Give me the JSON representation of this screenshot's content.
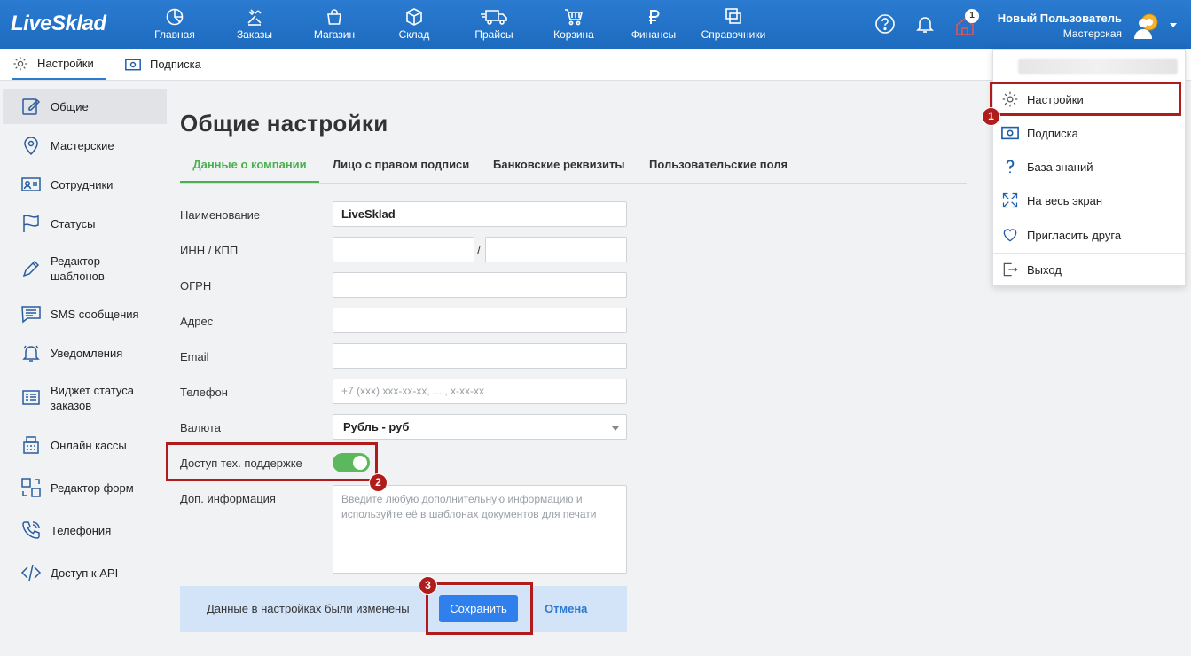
{
  "app": {
    "logo": "LiveSklad"
  },
  "nav": [
    {
      "label": "Главная",
      "icon": "pie-chart-icon"
    },
    {
      "label": "Заказы",
      "icon": "tools-icon"
    },
    {
      "label": "Магазин",
      "icon": "bag-icon"
    },
    {
      "label": "Склад",
      "icon": "box-icon"
    },
    {
      "label": "Прайсы",
      "icon": "truck-icon"
    },
    {
      "label": "Корзина",
      "icon": "cart-icon"
    },
    {
      "label": "Финансы",
      "icon": "ruble-icon"
    },
    {
      "label": "Справочники",
      "icon": "copy-icon"
    }
  ],
  "header": {
    "notification_count": "1",
    "user_name": "Новый Пользователь",
    "user_role": "Мастерская"
  },
  "subtabs": [
    {
      "label": "Настройки",
      "icon": "gear-icon"
    },
    {
      "label": "Подписка",
      "icon": "banknote-icon"
    }
  ],
  "sidebar": [
    {
      "label": "Общие",
      "icon": "edit-icon"
    },
    {
      "label": "Мастерские",
      "icon": "map-pin-icon"
    },
    {
      "label": "Сотрудники",
      "icon": "id-card-icon"
    },
    {
      "label": "Статусы",
      "icon": "flag-icon"
    },
    {
      "label": "Редактор шаблонов",
      "icon": "pencil-icon"
    },
    {
      "label": "SMS сообщения",
      "icon": "message-icon"
    },
    {
      "label": "Уведомления",
      "icon": "bell-icon"
    },
    {
      "label": "Виджет статуса заказов",
      "icon": "widget-icon"
    },
    {
      "label": "Онлайн кассы",
      "icon": "cash-register-icon"
    },
    {
      "label": "Редактор форм",
      "icon": "form-editor-icon"
    },
    {
      "label": "Телефония",
      "icon": "phone-icon"
    },
    {
      "label": "Доступ к API",
      "icon": "code-icon"
    }
  ],
  "main": {
    "title": "Общие настройки",
    "tabs": [
      "Данные о компании",
      "Лицо с правом подписи",
      "Банковские реквизиты",
      "Пользовательские поля"
    ],
    "fields": {
      "name_label": "Наименование",
      "name_value": "LiveSklad",
      "inn_label": "ИНН / КПП",
      "slash": "/",
      "ogrn_label": "ОГРН",
      "address_label": "Адрес",
      "email_label": "Email",
      "phone_label": "Телефон",
      "phone_placeholder": "+7 (xxx) xxx-xx-xx, ... , x-xx-xx",
      "currency_label": "Валюта",
      "currency_value": "Рубль - руб",
      "support_label": "Доступ тех. поддержке",
      "support_enabled": true,
      "info_label": "Доп. информация",
      "info_placeholder": "Введите любую дополнительную информацию и используйте её в шаблонах документов для печати"
    },
    "savebar": {
      "message": "Данные в настройках были изменены",
      "save": "Сохранить",
      "cancel": "Отмена"
    }
  },
  "dropdown": [
    {
      "label": "Настройки",
      "icon": "gear-icon"
    },
    {
      "label": "Подписка",
      "icon": "banknote-icon"
    },
    {
      "label": "База знаний",
      "icon": "question-icon"
    },
    {
      "label": "На весь экран",
      "icon": "fullscreen-icon"
    },
    {
      "label": "Пригласить друга",
      "icon": "heart-icon"
    },
    {
      "label": "Выход",
      "icon": "logout-icon"
    }
  ],
  "annotations": [
    "1",
    "2",
    "3"
  ],
  "colors": {
    "header": "#1d6bbf",
    "accent_green": "#4caf50",
    "annotation": "#b01c1c",
    "save_button": "#2f80ed"
  }
}
